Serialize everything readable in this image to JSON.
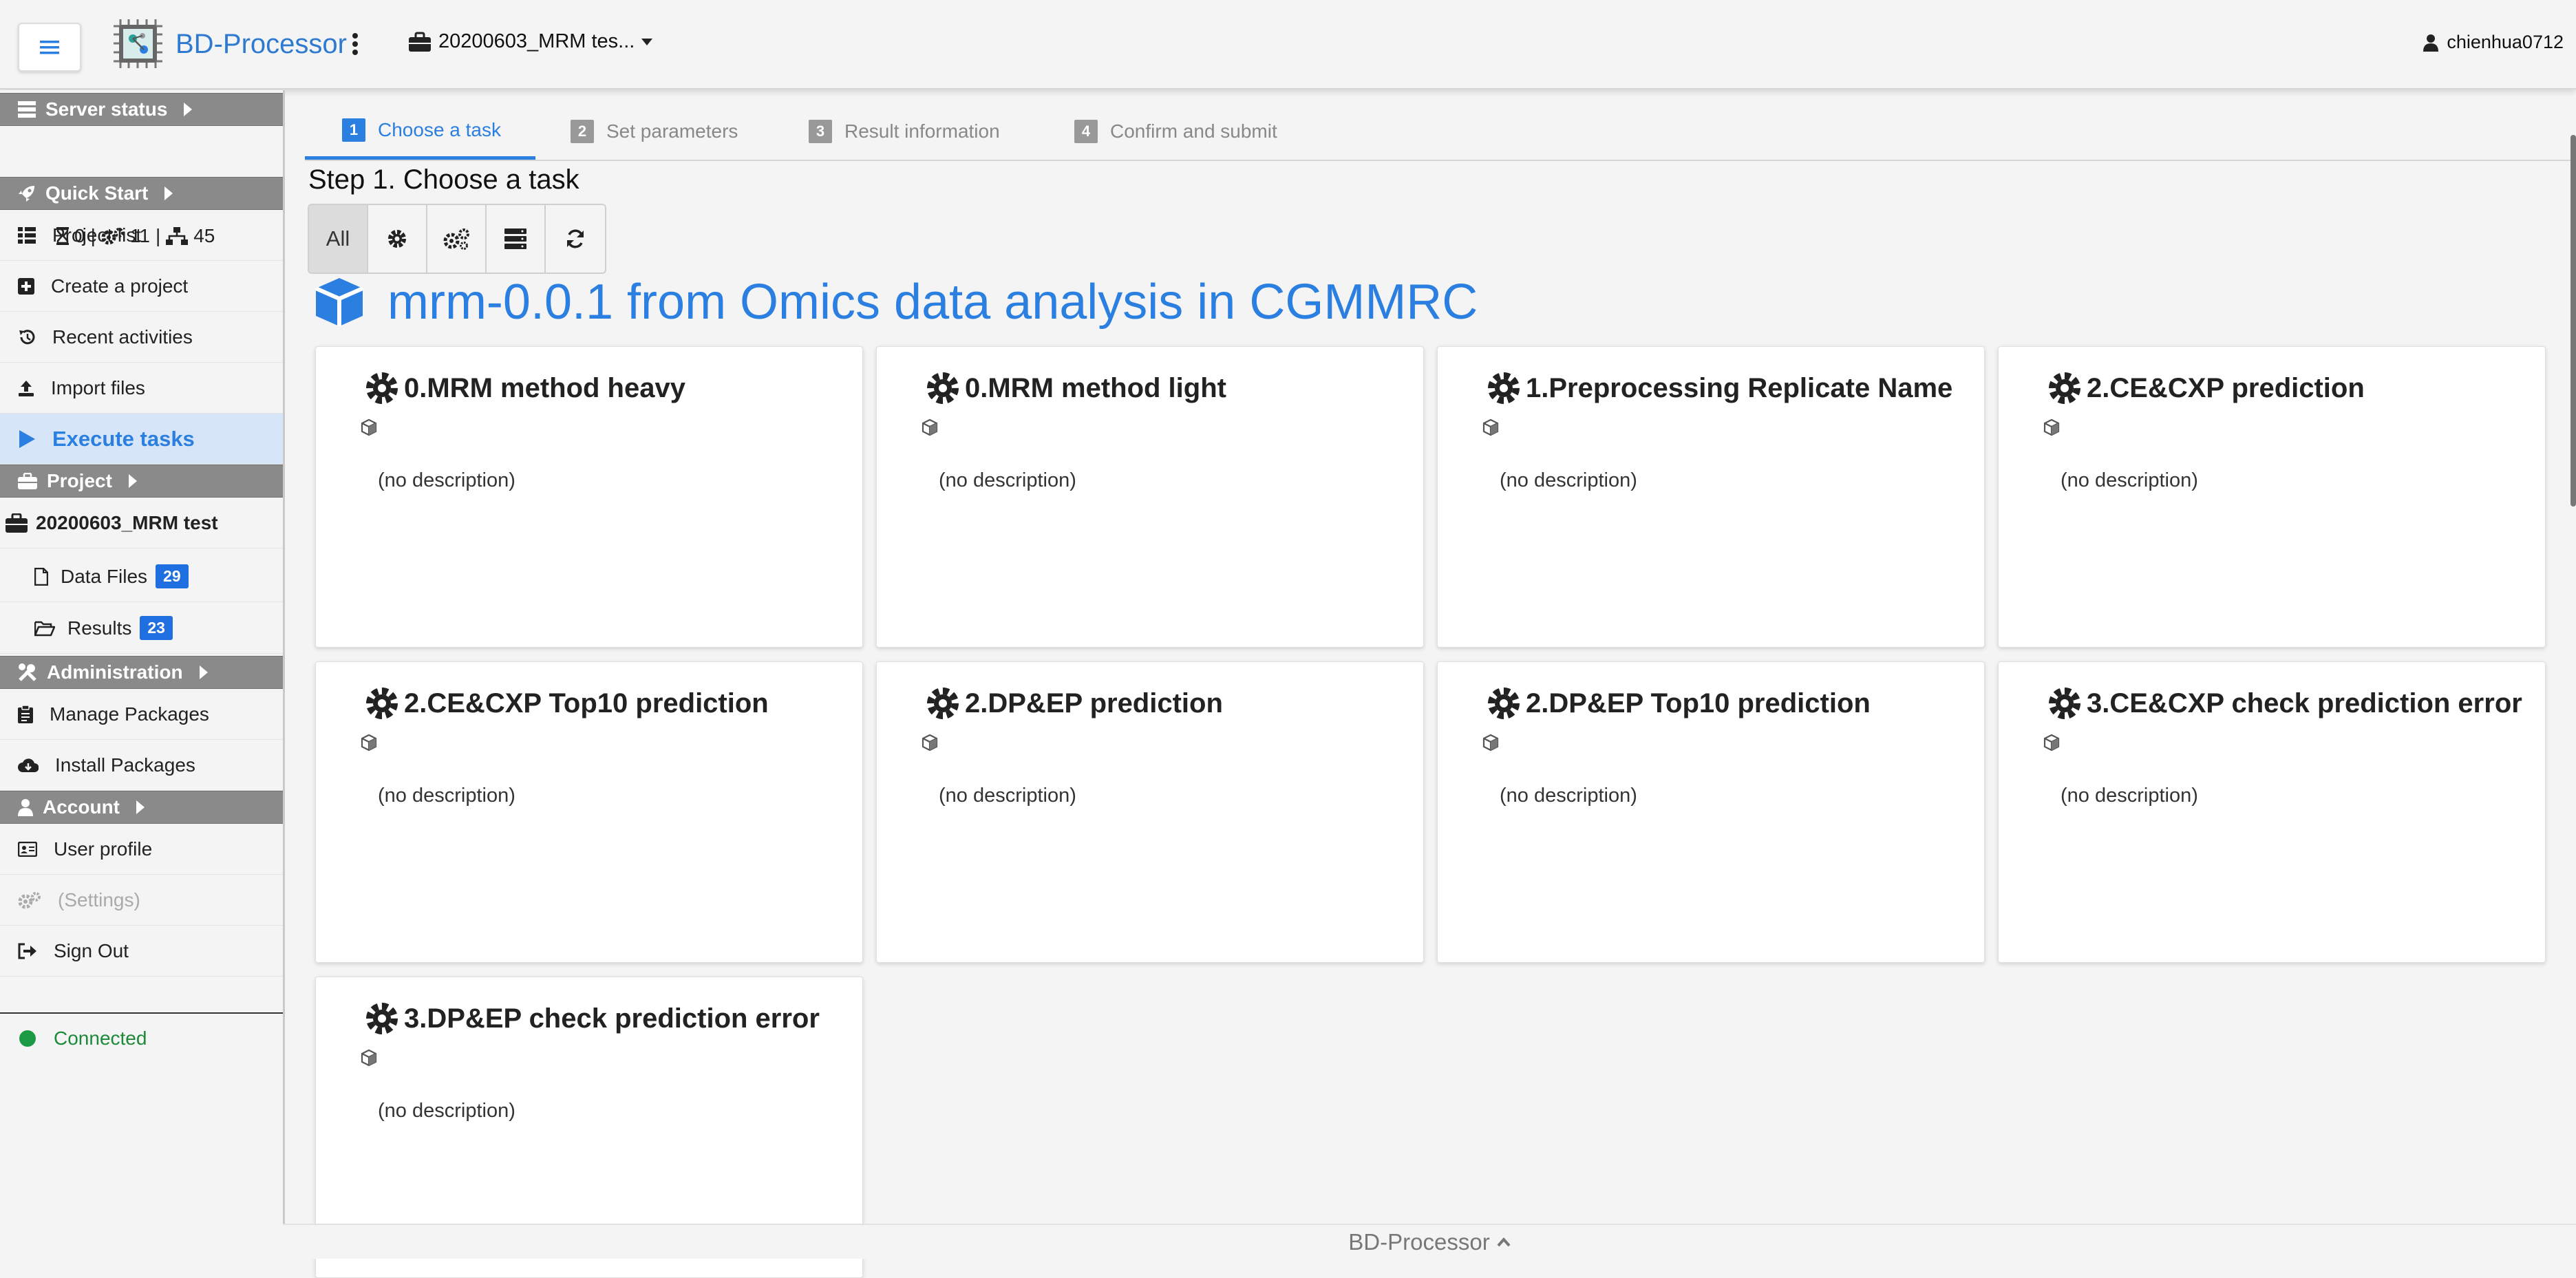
{
  "header": {
    "menu_icon": "hamburger-icon",
    "app_title": "BD-Processor",
    "project_name": "20200603_MRM tes...",
    "user_name": "chienhua0712"
  },
  "sidebar": {
    "server_status": {
      "title": "Server status",
      "waiting": "0",
      "running": "11",
      "nodes": "45"
    },
    "quick_start": {
      "title": "Quick Start",
      "items": [
        {
          "label": "Project list",
          "icon": "list-icon"
        },
        {
          "label": "Create a project",
          "icon": "plus-square-icon"
        },
        {
          "label": "Recent activities",
          "icon": "history-icon"
        },
        {
          "label": "Import files",
          "icon": "upload-icon"
        },
        {
          "label": "Execute tasks",
          "icon": "play-icon",
          "active": true
        }
      ]
    },
    "project": {
      "title": "Project",
      "name": "20200603_MRM test",
      "data_files_label": "Data Files",
      "data_files_count": "29",
      "results_label": "Results",
      "results_count": "23"
    },
    "administration": {
      "title": "Administration",
      "items": [
        {
          "label": "Manage Packages",
          "icon": "clipboard-icon"
        },
        {
          "label": "Install Packages",
          "icon": "cloud-download-icon"
        }
      ]
    },
    "account": {
      "title": "Account",
      "items": [
        {
          "label": "User profile",
          "icon": "id-card-icon"
        },
        {
          "label": "(Settings)",
          "icon": "gears-icon",
          "disabled": true
        },
        {
          "label": "Sign Out",
          "icon": "sign-out-icon"
        }
      ]
    },
    "connection": "Connected"
  },
  "steps": [
    {
      "num": "1",
      "label": "Choose a task",
      "active": true
    },
    {
      "num": "2",
      "label": "Set parameters"
    },
    {
      "num": "3",
      "label": "Result information"
    },
    {
      "num": "4",
      "label": "Confirm and submit"
    }
  ],
  "main": {
    "step_title": "Step 1. Choose a task",
    "filter_all": "All",
    "package_title": "mrm-0.0.1 from Omics data analysis in CGMMRC",
    "tasks": [
      {
        "name": "0.MRM method heavy",
        "description": "(no description)"
      },
      {
        "name": "0.MRM method light",
        "description": "(no description)"
      },
      {
        "name": "1.Preprocessing Replicate Name",
        "description": "(no description)"
      },
      {
        "name": "2.CE&CXP prediction",
        "description": "(no description)"
      },
      {
        "name": "2.CE&CXP Top10 prediction",
        "description": "(no description)"
      },
      {
        "name": "2.DP&EP prediction",
        "description": "(no description)"
      },
      {
        "name": "2.DP&EP Top10 prediction",
        "description": "(no description)"
      },
      {
        "name": "3.CE&CXP check prediction error",
        "description": "(no description)"
      },
      {
        "name": "3.DP&EP check prediction error",
        "description": "(no description)"
      }
    ]
  },
  "footer": {
    "label": "BD-Processor"
  },
  "colors": {
    "accent": "#2b7fe0",
    "badge": "#1f6fe0",
    "section_header": "#8a8a8a",
    "connected": "#1d9a46"
  }
}
